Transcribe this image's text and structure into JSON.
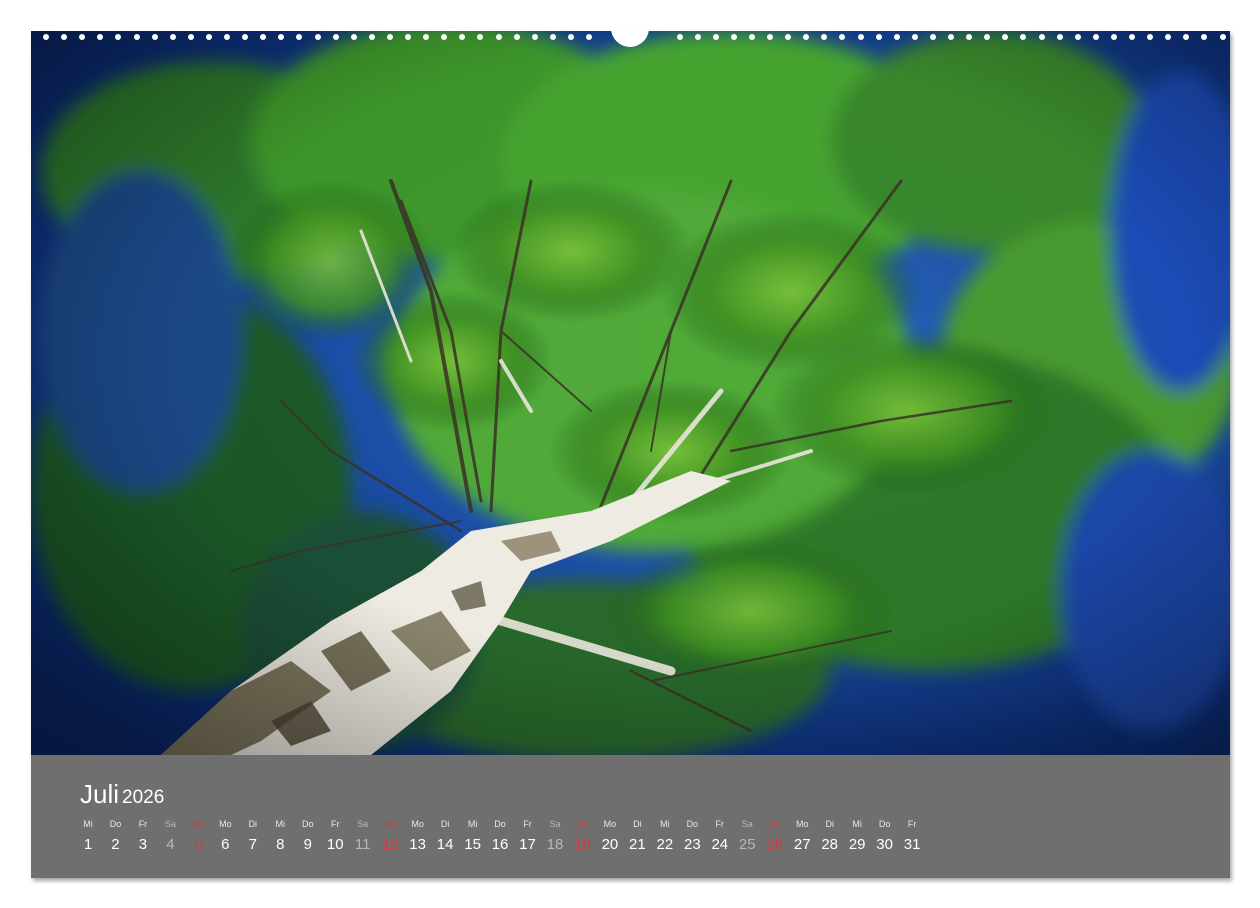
{
  "calendar": {
    "month": "Juli",
    "year": "2026",
    "days": [
      {
        "wd": "Mi",
        "d": "1",
        "t": "w"
      },
      {
        "wd": "Do",
        "d": "2",
        "t": "w"
      },
      {
        "wd": "Fr",
        "d": "3",
        "t": "w"
      },
      {
        "wd": "Sa",
        "d": "4",
        "t": "sat"
      },
      {
        "wd": "So",
        "d": "5",
        "t": "sun"
      },
      {
        "wd": "Mo",
        "d": "6",
        "t": "w"
      },
      {
        "wd": "Di",
        "d": "7",
        "t": "w"
      },
      {
        "wd": "Mi",
        "d": "8",
        "t": "w"
      },
      {
        "wd": "Do",
        "d": "9",
        "t": "w"
      },
      {
        "wd": "Fr",
        "d": "10",
        "t": "w"
      },
      {
        "wd": "Sa",
        "d": "11",
        "t": "sat"
      },
      {
        "wd": "So",
        "d": "12",
        "t": "sun"
      },
      {
        "wd": "Mo",
        "d": "13",
        "t": "w"
      },
      {
        "wd": "Di",
        "d": "14",
        "t": "w"
      },
      {
        "wd": "Mi",
        "d": "15",
        "t": "w"
      },
      {
        "wd": "Do",
        "d": "16",
        "t": "w"
      },
      {
        "wd": "Fr",
        "d": "17",
        "t": "w"
      },
      {
        "wd": "Sa",
        "d": "18",
        "t": "sat"
      },
      {
        "wd": "So",
        "d": "19",
        "t": "sun"
      },
      {
        "wd": "Mo",
        "d": "20",
        "t": "w"
      },
      {
        "wd": "Di",
        "d": "21",
        "t": "w"
      },
      {
        "wd": "Mi",
        "d": "22",
        "t": "w"
      },
      {
        "wd": "Do",
        "d": "23",
        "t": "w"
      },
      {
        "wd": "Fr",
        "d": "24",
        "t": "w"
      },
      {
        "wd": "Sa",
        "d": "25",
        "t": "sat"
      },
      {
        "wd": "So",
        "d": "26",
        "t": "sun"
      },
      {
        "wd": "Mo",
        "d": "27",
        "t": "w"
      },
      {
        "wd": "Di",
        "d": "28",
        "t": "w"
      },
      {
        "wd": "Mi",
        "d": "29",
        "t": "w"
      },
      {
        "wd": "Do",
        "d": "30",
        "t": "w"
      },
      {
        "wd": "Fr",
        "d": "31",
        "t": "w"
      }
    ]
  },
  "colors": {
    "band": "#6f6f6f",
    "sunday": "#d63a3a",
    "saturday": "#b8b8b8",
    "sky": "#1c4fa8",
    "foliage": "#4a9a2a"
  },
  "photo": {
    "subject": "birch-tree-icon"
  }
}
